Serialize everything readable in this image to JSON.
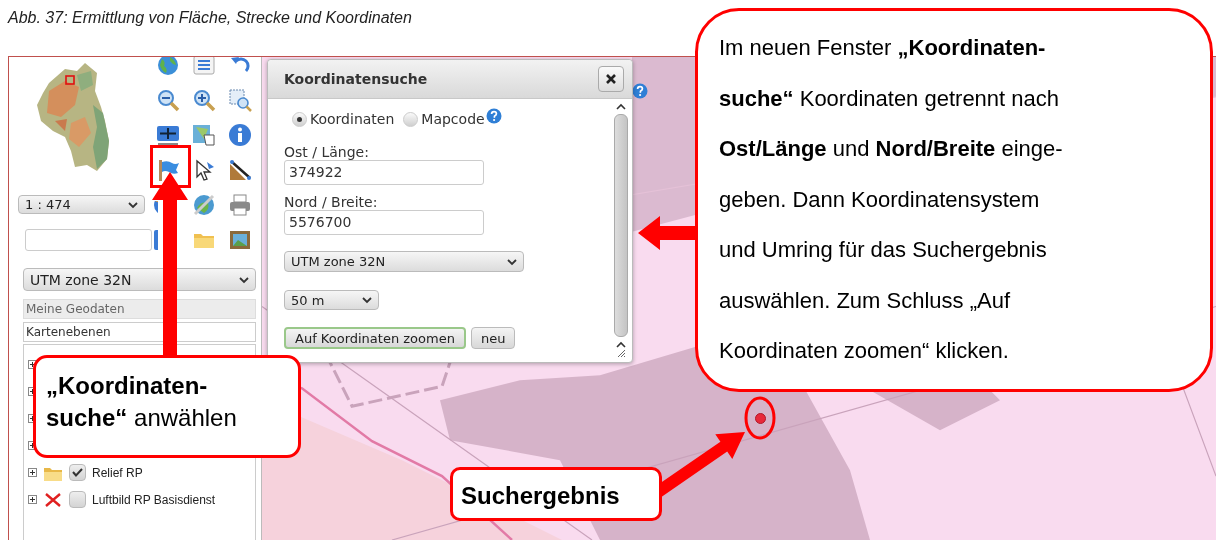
{
  "caption": "Abb. 37: Ermittlung von Fläche, Strecke und Koordinaten",
  "sidebar": {
    "scale": "1 : 474",
    "crs": "UTM zone 32N",
    "panel_title": "Meine Geodaten",
    "tab": "Kartenebenen"
  },
  "layers": [
    {
      "expanded": false
    },
    {
      "expanded": false
    },
    {
      "expanded": false
    },
    {
      "expanded": false
    },
    {
      "expanded": false,
      "kind": "folder",
      "label": "Relief RP",
      "checked": true
    },
    {
      "expanded": false,
      "kind": "error",
      "label": "Luftbild RP Basisdienst",
      "checked": false
    }
  ],
  "dialog": {
    "title": "Koordinatensuche",
    "modes": [
      {
        "label": "Koordinaten",
        "selected": true
      },
      {
        "label": "Mapcode",
        "selected": false
      }
    ],
    "fields": [
      {
        "label": "Ost / Länge:",
        "value": "374922"
      },
      {
        "label": "Nord / Breite:",
        "value": "5576700"
      }
    ],
    "crs": "UTM zone 32N",
    "buffer": "50 m",
    "buttons": [
      {
        "label": "Auf Koordinaten zoomen",
        "default": true
      },
      {
        "label": "neu",
        "default": false
      }
    ]
  },
  "annotations": {
    "main": "Im neuen Fenster **„Koordinaten-**\n**suche“** Koordinaten getrennt nach\n**Ost/Länge** und **Nord/Breite** einge-\ngeben. Dann Koordinatensystem\nund Umring für das Suchergebnis\nauswählen. Zum Schluss „Auf\nKoordinaten zoomen“ klicken.",
    "tool_hint": "**„Koordinaten-**\n**suche“** anwählen",
    "result": "Suchergebnis"
  }
}
